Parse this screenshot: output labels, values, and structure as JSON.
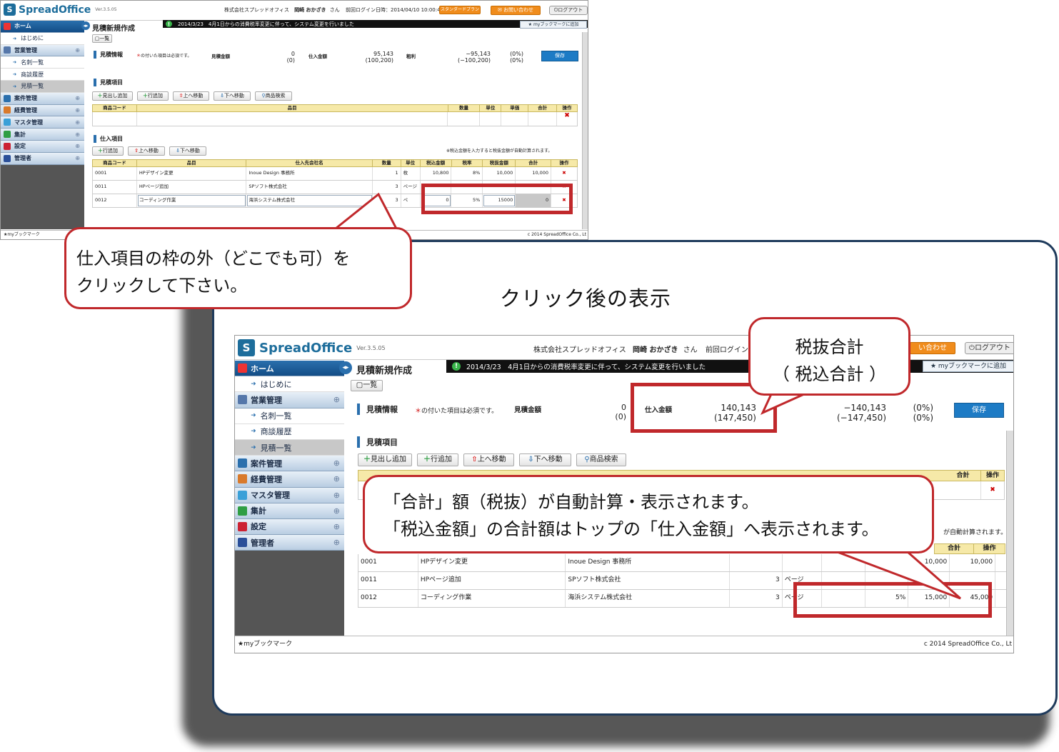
{
  "app": {
    "brand": "SpreadOffice",
    "version": "Ver.3.5.05",
    "company_prefix": "株式会社スプレッドオフィス",
    "user_name": "岡崎 おかざき",
    "user_suffix": "さん",
    "last_login": "前回ログイン日時：2014/04/10 10:00:47",
    "last_login_short": "前回ログイン日時:",
    "plan_badge": "スタンダードプラン",
    "contact_button": "お問い合わせ",
    "contact_button_partial": "い合わせ",
    "logout_button": "ログアウト",
    "notice": "2014/3/23　4月1日からの消費税率変更に伴って、システム変更を行いました",
    "bookmark_add": "myブックマークに追加",
    "bookmark_footer": "myブックマーク",
    "copyright": "c 2014 SpreadOffice Co., Lt",
    "page_title": "見積新規作成"
  },
  "sidebar": {
    "items": [
      {
        "label": "ホーム",
        "type": "home"
      },
      {
        "label": "はじめに",
        "type": "sub"
      },
      {
        "label": "営業管理",
        "type": "group"
      },
      {
        "label": "名刺一覧",
        "type": "sub"
      },
      {
        "label": "商談履歴",
        "type": "sub"
      },
      {
        "label": "見積一覧",
        "type": "sub-active"
      },
      {
        "label": "案件管理",
        "type": "group"
      },
      {
        "label": "経費管理",
        "type": "group"
      },
      {
        "label": "マスタ管理",
        "type": "group"
      },
      {
        "label": "集計",
        "type": "group"
      },
      {
        "label": "設定",
        "type": "group"
      },
      {
        "label": "管理者",
        "type": "group"
      }
    ]
  },
  "toolbar": {
    "list_button": "一覧"
  },
  "estimate_info": {
    "section": "見積情報",
    "required_note": "の付いた項目は必須です。",
    "estimate_amount_label": "見積金額",
    "estimate_amount": "0",
    "estimate_amount_tax": "(0)",
    "purchase_amount_label": "仕入金額",
    "gross_profit_label": "粗利",
    "save_button": "保存"
  },
  "before": {
    "purchase_amount": "95,143",
    "purchase_amount_tax": "(100,200)",
    "gross_profit": "−95,143",
    "gross_profit_tax": "(−100,200)",
    "rate": "(0%)",
    "rate_tax": "(0%)"
  },
  "after": {
    "purchase_amount": "140,143",
    "purchase_amount_tax": "(147,450)",
    "gross_profit": "−140,143",
    "gross_profit_tax": "(−147,450)",
    "rate": "(0%)",
    "rate_tax": "(0%)"
  },
  "estimate_items": {
    "section": "見積項目",
    "buttons": [
      "見出し追加",
      "行追加",
      "上へ移動",
      "下へ移動",
      "商品検索"
    ],
    "columns": [
      "商品コード",
      "品目",
      "数量",
      "単位",
      "単価",
      "合計",
      "操作"
    ]
  },
  "purchase_items": {
    "section": "仕入項目",
    "buttons": [
      "行追加",
      "上へ移動",
      "下へ移動"
    ],
    "note": "※税込金額を入力すると税抜金額が自動計算されます。",
    "note_partial": "が自動計算されます。",
    "columns": [
      "商品コード",
      "品目",
      "仕入先会社名",
      "数量",
      "単位",
      "税込金額",
      "税率",
      "税抜金額",
      "合計",
      "操作"
    ],
    "columns_visible_after": [
      "合計",
      "操作"
    ],
    "rows_before": [
      {
        "code": "0001",
        "item": "HPデザイン変更",
        "supplier": "Inoue Design 事務所",
        "qty": "1",
        "unit": "枚",
        "tax_in": "10,800",
        "rate": "8%",
        "tax_ex": "10,000",
        "total": "10,000"
      },
      {
        "code": "0011",
        "item": "HPページ追加",
        "supplier": "SPソフト株式会社",
        "qty": "3",
        "unit": "ページ",
        "tax_in": "",
        "rate": "",
        "tax_ex": "",
        "total": ""
      },
      {
        "code": "0012",
        "item": "コーディング作業",
        "supplier": "海浜システム株式会社",
        "qty": "3",
        "unit": "ペ",
        "tax_in": "0",
        "rate": "5%",
        "tax_ex": "15000",
        "total": "0"
      }
    ],
    "rows_after": [
      {
        "code": "0001",
        "item": "HPデザイン変更",
        "supplier": "Inoue Design 事務所",
        "qty": "",
        "unit": "",
        "tax_in": "",
        "rate": "8%",
        "tax_ex": "10,000",
        "total": "10,000"
      },
      {
        "code": "0011",
        "item": "HPページ追加",
        "supplier": "SPソフト株式会社",
        "qty": "3",
        "unit": "ページ",
        "tax_in": "",
        "rate": "",
        "tax_ex": "",
        "total": ""
      },
      {
        "code": "0012",
        "item": "コーディング作業",
        "supplier": "海浜システム株式会社",
        "qty": "3",
        "unit": "ページ",
        "tax_in": "",
        "rate": "5%",
        "tax_ex": "15,000",
        "total": "45,000"
      }
    ]
  },
  "annotations": {
    "click_outside_line1": "仕入項目の枠の外（どこでも可）を",
    "click_outside_line2": "クリックして下さい。",
    "after_title": "クリック後の表示",
    "subtotal_line1": "税抜合計",
    "subtotal_line2": "（ 税込合計 ）",
    "auto_calc_line1": "「合計」額（税抜）が自動計算・表示されます。",
    "auto_calc_line2": "「税込金額」の合計額はトップの「仕入金額」へ表示されます。"
  },
  "colors": {
    "accent": "#2a6fad",
    "callout_border": "#c0282b",
    "table_header": "#f6e9a8",
    "save": "#1d7bc5"
  }
}
